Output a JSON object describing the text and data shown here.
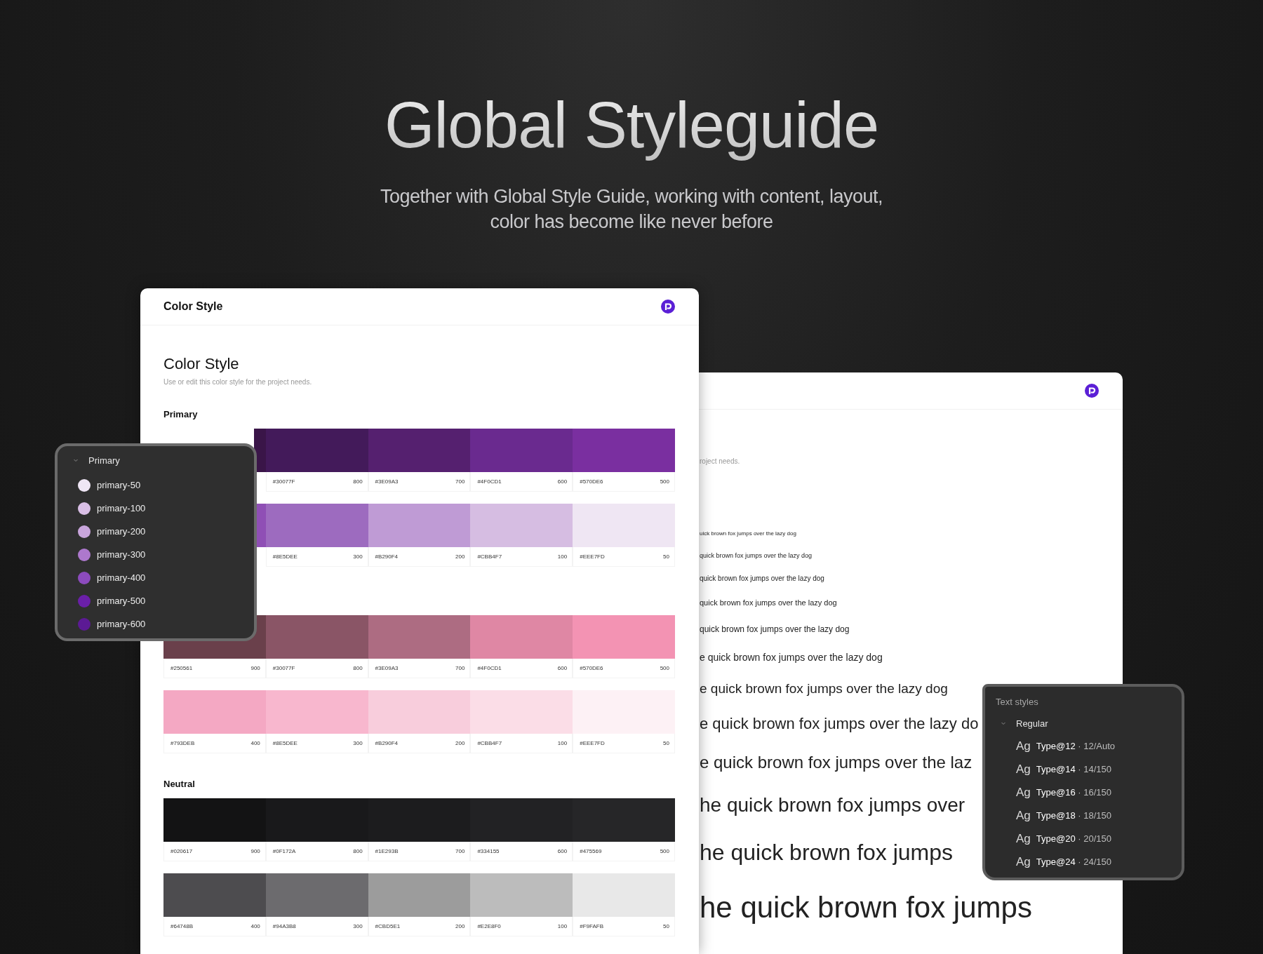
{
  "hero": {
    "title": "Global Styleguide",
    "subtitle_lines": [
      "Together with Global Style Guide, working with content, layout,",
      "color has become like never before"
    ]
  },
  "color_card": {
    "header_title": "Color Style",
    "heading": "Color Style",
    "description": "Use or edit this color style for the project needs.",
    "groups": [
      {
        "label": "Primary",
        "rows": [
          [
            {
              "color": "#3a1548"
            },
            {
              "hex": "#30077F",
              "value": "800",
              "color": "#431a5a"
            },
            {
              "hex": "#3E09A3",
              "value": "700",
              "color": "#55206f"
            },
            {
              "hex": "#4F0CD1",
              "value": "600",
              "color": "#6a2a8f"
            },
            {
              "hex": "#570DE6",
              "value": "500",
              "color": "#7a2fa0"
            }
          ],
          [
            {
              "color": "#8f4fb5"
            },
            {
              "hex": "#8E5DEE",
              "value": "300",
              "color": "#9d6bbf"
            },
            {
              "hex": "#B290F4",
              "value": "200",
              "color": "#bf9bd5"
            },
            {
              "hex": "#CBB4F7",
              "value": "100",
              "color": "#d6bde2"
            },
            {
              "hex": "#EEE7FD",
              "value": "50",
              "color": "#efe6f3"
            }
          ]
        ]
      },
      {
        "rows": [
          [
            {
              "hex": "#250561",
              "value": "900",
              "color": "#6a404b"
            },
            {
              "hex": "#30077F",
              "value": "800",
              "color": "#8a5566"
            },
            {
              "hex": "#3E09A3",
              "value": "700",
              "color": "#ad6c82"
            },
            {
              "hex": "#4F0CD1",
              "value": "600",
              "color": "#df87a4"
            },
            {
              "hex": "#570DE6",
              "value": "500",
              "color": "#f393b3"
            }
          ],
          [
            {
              "hex": "#793DEB",
              "value": "400",
              "color": "#f4a8c3"
            },
            {
              "hex": "#8E5DEE",
              "value": "300",
              "color": "#f8b7ce"
            },
            {
              "hex": "#B290F4",
              "value": "200",
              "color": "#f8cddc"
            },
            {
              "hex": "#CBB4F7",
              "value": "100",
              "color": "#fbdde7"
            },
            {
              "hex": "#EEE7FD",
              "value": "50",
              "color": "#fdf1f5"
            }
          ]
        ]
      },
      {
        "label": "Neutral",
        "rows": [
          [
            {
              "hex": "#020617",
              "value": "900",
              "color": "#131314"
            },
            {
              "hex": "#0F172A",
              "value": "800",
              "color": "#19191b"
            },
            {
              "hex": "#1E293B",
              "value": "700",
              "color": "#1c1c1e"
            },
            {
              "hex": "#334155",
              "value": "600",
              "color": "#222224"
            },
            {
              "hex": "#475569",
              "value": "500",
              "color": "#262628"
            }
          ],
          [
            {
              "hex": "#64748B",
              "value": "400",
              "color": "#4d4c4f"
            },
            {
              "hex": "#94A3B8",
              "value": "300",
              "color": "#6c6b6e"
            },
            {
              "hex": "#CBD5E1",
              "value": "200",
              "color": "#9c9c9c"
            },
            {
              "hex": "#E2E8F0",
              "value": "100",
              "color": "#bcbcbc"
            },
            {
              "hex": "#F9FAFB",
              "value": "50",
              "color": "#e8e8e8"
            }
          ]
        ]
      }
    ]
  },
  "type_card": {
    "description": "roject needs.",
    "samples": [
      "uick brown fox jumps over the lazy dog",
      "quick brown fox jumps over the lazy dog",
      "quick brown fox jumps over the lazy dog",
      "quick brown fox jumps over the lazy dog",
      "quick brown fox jumps over the lazy dog",
      "e quick brown fox jumps over the lazy dog",
      "e quick brown fox jumps over the lazy dog",
      "e quick brown fox jumps over the lazy do",
      "e quick brown fox jumps over the laz",
      "he quick brown fox jumps over",
      "he quick brown fox jumps",
      "he quick brown fox jumps"
    ]
  },
  "color_panel": {
    "group": "Primary",
    "expanded": true,
    "items": [
      {
        "name": "primary-50",
        "color": "#efe6f5"
      },
      {
        "name": "primary-100",
        "color": "#d9bfe6"
      },
      {
        "name": "primary-200",
        "color": "#c9a5dc"
      },
      {
        "name": "primary-300",
        "color": "#ad78cd"
      },
      {
        "name": "primary-400",
        "color": "#8c4bbd"
      },
      {
        "name": "primary-500",
        "color": "#6a1fa8"
      },
      {
        "name": "primary-600",
        "color": "#5c1a95"
      }
    ]
  },
  "text_panel": {
    "title": "Text styles",
    "group": "Regular",
    "expanded": true,
    "items": [
      {
        "sample": "Ag",
        "label": "**Type@12** · 12/Auto"
      },
      {
        "sample": "Ag",
        "label": "**Type@14** · 14/150"
      },
      {
        "sample": "Ag",
        "label": "**Type@16** · 16/150"
      },
      {
        "sample": "Ag",
        "label": "**Type@18** · 18/150"
      },
      {
        "sample": "Ag",
        "label": "**Type@20** · 20/150"
      },
      {
        "sample": "Ag",
        "label": "**Type@24** · 24/150"
      }
    ]
  }
}
